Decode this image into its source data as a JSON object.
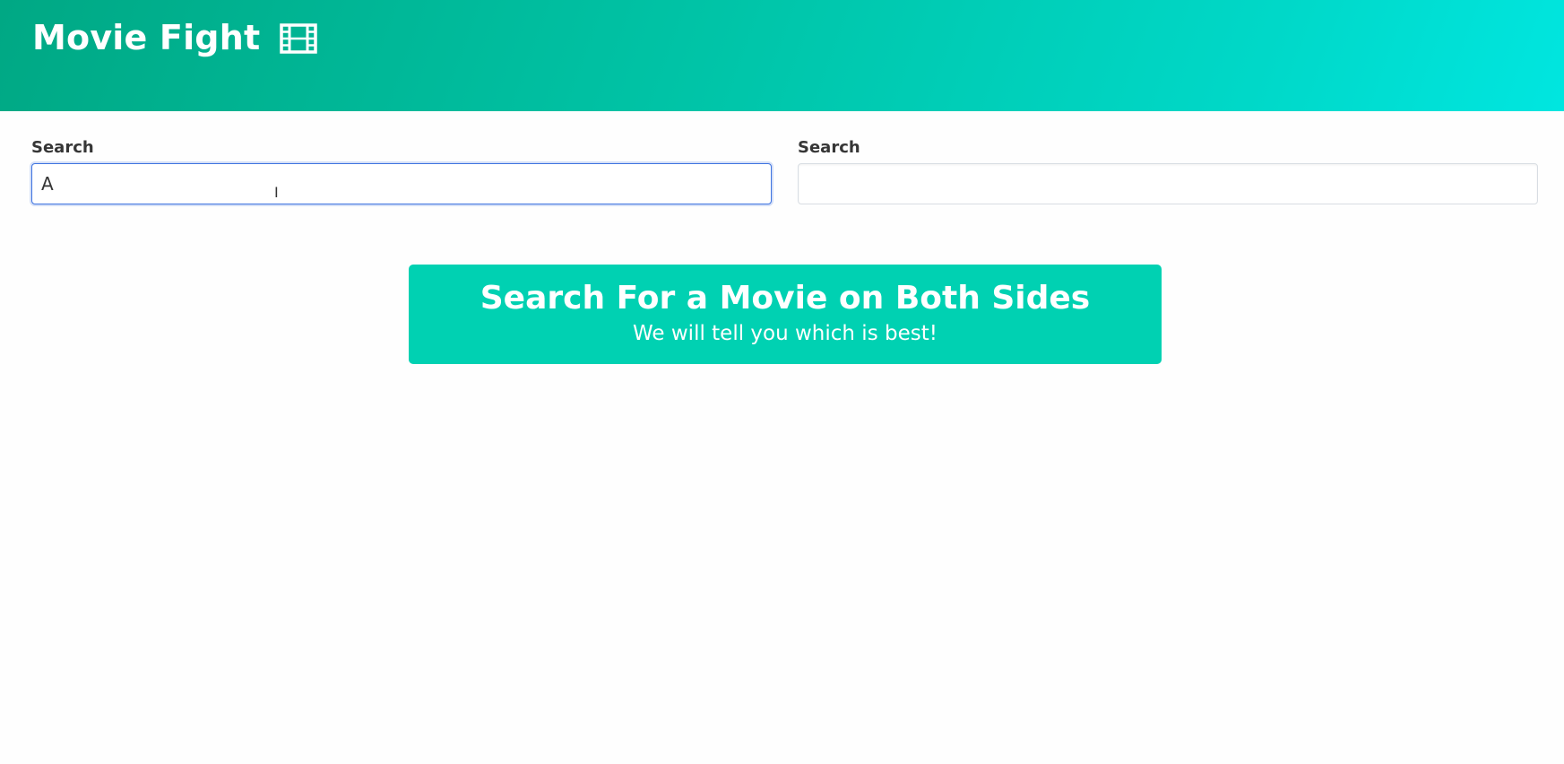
{
  "header": {
    "title": "Movie Fight",
    "icon": "film-icon",
    "gradient_start": "#00a884",
    "gradient_end": "#00e6e0"
  },
  "search_left": {
    "label": "Search",
    "value": "A",
    "placeholder": ""
  },
  "search_right": {
    "label": "Search",
    "value": "",
    "placeholder": ""
  },
  "notice": {
    "title": "Search For a Movie on Both Sides",
    "subtitle": "We will tell you which is best!",
    "color": "#00d1b2"
  }
}
